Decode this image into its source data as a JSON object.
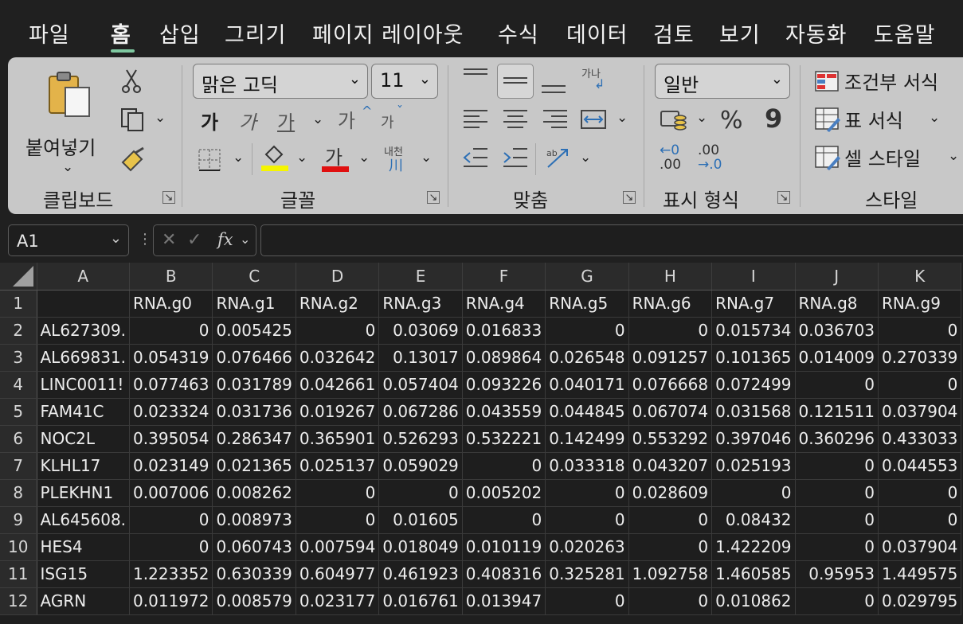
{
  "menu": {
    "tabs": [
      "파일",
      "홈",
      "삽입",
      "그리기",
      "페이지 레이아웃",
      "수식",
      "데이터",
      "검토",
      "보기",
      "자동화",
      "도움말"
    ],
    "active": "홈"
  },
  "ribbon": {
    "clipboard": {
      "paste_label": "붙여넣기",
      "group_label": "클립보드"
    },
    "font": {
      "font_name": "맑은 고딕",
      "font_size": "11",
      "bold": "가",
      "italic": "가",
      "underline": "가",
      "grow": "가",
      "shrink": "가",
      "font_color_glyph": "가",
      "phonetic": "내천",
      "group_label": "글꼴",
      "highlight_color": "#f5f500",
      "font_color": "#e01010"
    },
    "alignment": {
      "orient_glyph": "가나",
      "group_label": "맞춤"
    },
    "number": {
      "format": "일반",
      "percent": "%",
      "comma": "9",
      "inc_decimal_top": "←0",
      "inc_decimal_bottom": ".00",
      "dec_decimal_top": ".00",
      "dec_decimal_bottom": "→.0",
      "group_label": "표시 형식"
    },
    "styles": {
      "conditional": "조건부 서식",
      "table_format": "표 서식",
      "cell_styles": "셀 스타일",
      "group_label": "스타일"
    }
  },
  "formula_bar": {
    "name_box": "A1",
    "fx": "fx",
    "formula": ""
  },
  "sheet": {
    "columns": [
      "A",
      "B",
      "C",
      "D",
      "E",
      "F",
      "G",
      "H",
      "I",
      "J",
      "K"
    ],
    "rows": [
      [
        "",
        "RNA.g0",
        "RNA.g1",
        "RNA.g2",
        "RNA.g3",
        "RNA.g4",
        "RNA.g5",
        "RNA.g6",
        "RNA.g7",
        "RNA.g8",
        "RNA.g9"
      ],
      [
        "AL627309.",
        "0",
        "0.005425",
        "0",
        "0.03069",
        "0.016833",
        "0",
        "0",
        "0.015734",
        "0.036703",
        "0"
      ],
      [
        "AL669831.",
        "0.054319",
        "0.076466",
        "0.032642",
        "0.13017",
        "0.089864",
        "0.026548",
        "0.091257",
        "0.101365",
        "0.014009",
        "0.270339"
      ],
      [
        "LINC0011!",
        "0.077463",
        "0.031789",
        "0.042661",
        "0.057404",
        "0.093226",
        "0.040171",
        "0.076668",
        "0.072499",
        "0",
        "0"
      ],
      [
        "FAM41C",
        "0.023324",
        "0.031736",
        "0.019267",
        "0.067286",
        "0.043559",
        "0.044845",
        "0.067074",
        "0.031568",
        "0.121511",
        "0.037904"
      ],
      [
        "NOC2L",
        "0.395054",
        "0.286347",
        "0.365901",
        "0.526293",
        "0.532221",
        "0.142499",
        "0.553292",
        "0.397046",
        "0.360296",
        "0.433033"
      ],
      [
        "KLHL17",
        "0.023149",
        "0.021365",
        "0.025137",
        "0.059029",
        "0",
        "0.033318",
        "0.043207",
        "0.025193",
        "0",
        "0.044553"
      ],
      [
        "PLEKHN1",
        "0.007006",
        "0.008262",
        "0",
        "0",
        "0.005202",
        "0",
        "0.028609",
        "0",
        "0",
        "0"
      ],
      [
        "AL645608.",
        "0",
        "0.008973",
        "0",
        "0.01605",
        "0",
        "0",
        "0",
        "0.08432",
        "0",
        "0"
      ],
      [
        "HES4",
        "0",
        "0.060743",
        "0.007594",
        "0.018049",
        "0.010119",
        "0.020263",
        "0",
        "1.422209",
        "0",
        "0.037904"
      ],
      [
        "ISG15",
        "1.223352",
        "0.630339",
        "0.604977",
        "0.461923",
        "0.408316",
        "0.325281",
        "1.092758",
        "1.460585",
        "0.95953",
        "1.449575"
      ],
      [
        "AGRN",
        "0.011972",
        "0.008579",
        "0.023177",
        "0.016761",
        "0.013947",
        "0",
        "0",
        "0.010862",
        "0",
        "0.029795"
      ]
    ]
  }
}
